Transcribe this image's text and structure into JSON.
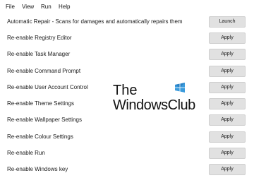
{
  "menu": {
    "items": [
      {
        "label": "File"
      },
      {
        "label": "View"
      },
      {
        "label": "Run"
      },
      {
        "label": "Help"
      }
    ]
  },
  "rows": [
    {
      "label": "Automatic Repair - Scans for damages and automatically repairs them",
      "button": "Launch"
    },
    {
      "label": "Re-enable Registry Editor",
      "button": "Apply"
    },
    {
      "label": "Re-enable Task Manager",
      "button": "Apply"
    },
    {
      "label": "Re-enable Command Prompt",
      "button": "Apply"
    },
    {
      "label": "Re-enable User Account Control",
      "button": "Apply"
    },
    {
      "label": "Re-enable Theme Settings",
      "button": "Apply"
    },
    {
      "label": "Re-enable Wallpaper Settings",
      "button": "Apply"
    },
    {
      "label": "Re-enable Colour Settings",
      "button": "Apply"
    },
    {
      "label": "Re-enable Run",
      "button": "Apply"
    },
    {
      "label": "Re-enable Windows key",
      "button": "Apply"
    }
  ],
  "watermark": {
    "line1": "The",
    "line2": "WindowsClub",
    "logo_colors": [
      "#3a9bdc",
      "#1f6fb5"
    ]
  }
}
